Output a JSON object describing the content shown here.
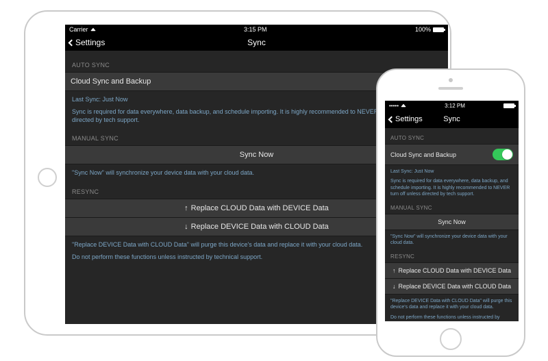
{
  "ipad": {
    "status": {
      "carrier": "Carrier",
      "time": "3:15 PM",
      "battery": "100%"
    },
    "nav": {
      "back": "Settings",
      "title": "Sync"
    },
    "auto": {
      "header": "AUTO SYNC",
      "row": "Cloud Sync and Backup",
      "last": "Last Sync: Just Now",
      "desc": "Sync is required for data everywhere, data backup, and schedule importing. It is highly recommended to NEVER turn off unless directed by tech support."
    },
    "manual": {
      "header": "MANUAL SYNC",
      "button": "Sync Now",
      "desc": "\"Sync Now\" will synchronize your device data with your cloud data."
    },
    "resync": {
      "header": "RESYNC",
      "opt1": "Replace CLOUD Data with DEVICE Data",
      "opt2": "Replace DEVICE Data with CLOUD Data",
      "desc1": "\"Replace DEVICE Data with CLOUD Data\" will purge this device's data and replace it with your cloud data.",
      "desc2": "Do not perform these functions unless instructed by technical support."
    }
  },
  "iphone": {
    "status": {
      "time": "3:12 PM"
    },
    "nav": {
      "back": "Settings",
      "title": "Sync"
    },
    "auto": {
      "header": "AUTO SYNC",
      "row": "Cloud Sync and Backup",
      "last": "Last Sync: Just Now",
      "desc": "Sync is required for data everywhere, data backup, and schedule importing. It is highly recommended to NEVER turn off unless directed by tech support."
    },
    "manual": {
      "header": "MANUAL SYNC",
      "button": "Sync Now",
      "desc": "\"Sync Now\" will synchronize your device data with your cloud data."
    },
    "resync": {
      "header": "RESYNC",
      "opt1": "Replace CLOUD Data with DEVICE Data",
      "opt2": "Replace DEVICE Data with CLOUD Data",
      "desc1": "\"Replace DEVICE Data with CLOUD Data\" will purge this device's data and replace it with your cloud data.",
      "desc2": "Do not perform these functions unless instructed by technical support."
    }
  }
}
